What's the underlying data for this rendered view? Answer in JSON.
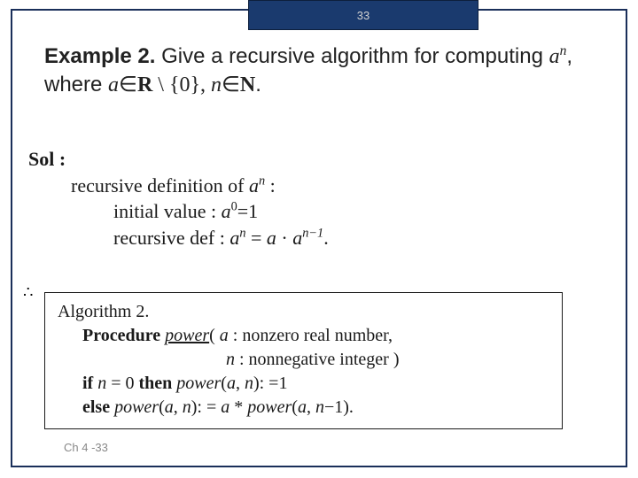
{
  "header": {
    "page_number": "33"
  },
  "example": {
    "label": "Example 2.",
    "prefix": "  Give a recursive algorithm for computing ",
    "expr1_a": "a",
    "expr1_sup": "n",
    "mid": ", where ",
    "expr2_a": "a",
    "in1": "∈",
    "setR": "R",
    "setminus": " \\ {0}, ",
    "expr3_n": "n",
    "in2": "∈",
    "setN": "N",
    "end": "."
  },
  "sol": {
    "label": "Sol :",
    "line1_pre": "recursive definition of ",
    "line1_a": "a",
    "line1_sup": "n",
    "line1_post": " :",
    "line2_pre": "initial value : ",
    "line2_a": "a",
    "line2_sup": "0",
    "line2_post": "=1",
    "line3_pre": "recursive def : ",
    "line3_a1": "a",
    "line3_sup1": "n",
    "line3_eq": " = ",
    "line3_a2": "a",
    "line3_dot": " · ",
    "line3_a3": "a",
    "line3_sup2": "n−1",
    "line3_post": "."
  },
  "therefore": "∴",
  "algo": {
    "title": "Algorithm 2.",
    "proc_label": "Procedure ",
    "proc_name": "power",
    "proc_open": "( ",
    "proc_a": "a",
    "proc_a_desc": " : nonzero real number,",
    "proc_n": "n",
    "proc_n_desc": " : nonnegative integer )",
    "if_kw": "if  ",
    "if_n": "n",
    "if_eq": " = 0   ",
    "then_kw": "then  ",
    "then_call": "power",
    "then_open": "(",
    "then_a": "a",
    "then_c1": ", ",
    "then_n": "n",
    "then_close": "): =1",
    "else_kw": "else ",
    "else_call1": "power",
    "else_open1": "(",
    "else_a1": "a",
    "else_c1": ", ",
    "else_n1": "n",
    "else_mid": "): = ",
    "else_a2": "a",
    "else_star": " * ",
    "else_call2": "power",
    "else_open2": "(",
    "else_a3": "a",
    "else_c2": ", ",
    "else_n2": "n",
    "else_minus": "−1).",
    "else_end": ""
  },
  "footer": {
    "label": "Ch 4 -33"
  }
}
